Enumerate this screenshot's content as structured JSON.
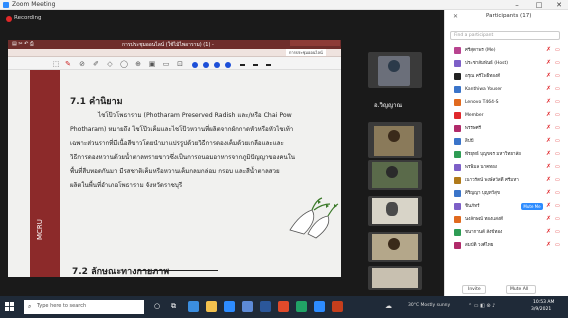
{
  "window": {
    "title": "Zoom Meeting",
    "minimize": "–",
    "maximize": "□",
    "close": "✕"
  },
  "recording": {
    "label": "Recording"
  },
  "shared_window": {
    "title": "การประชุมออนไลน์ (ใช้ไม้ไพอาราม) (1) - ",
    "tab_label": "การประชุมออนไลน์"
  },
  "document": {
    "side_label": "MCRU",
    "section_title": "7.1 คำนิยาม",
    "paragraphs": [
      "ไชโป๊วโพธาราม (Photharam Preserved Radish และ/หรือ Chai Pow",
      "Photharam) หมายถึง ไชโป๊วเค็มและไชโป๊วหวานที่ผลิตจากผักกาดหัวหรือหัวไชเท้า",
      "เฉพาะส่วนรากที่มีเนื้อสีขาวโดยนำมาแปรรูปด้วยวิธีการดองเค็มด้วยเกลือและและ",
      "วิธีการดองหวานด้วยน้ำตาลทรายขาวซึ่งเป็นการถนอมอาหารจากภูมิปัญญาของคนใน",
      "พื้นที่สืบทอดกันมา มีรสชาติเค็มหรือหวานเค็มกลมกล่อม กรอบ และสีน้ำตาลสวย",
      "ผลิตในพื้นที่อำเภอโพธาราม จังหวัดราชบุรี"
    ],
    "section_title2": "7.2 ลักษณะทางกายภาพ"
  },
  "videos": {
    "center_label": "อ.วิญญาณ"
  },
  "participants": {
    "title": "Participants (17)",
    "search_placeholder": "Find a participant",
    "items": [
      {
        "name": "ศรีสุดาพร (Me)",
        "color": "#b8438f"
      },
      {
        "name": "ประชาสัมพันธ์ (Host)",
        "color": "#7d5fc7"
      },
      {
        "name": "อรุณ ครีโพธิ์ทองดี",
        "color": "#222222"
      },
      {
        "name": "Kanthiwa Youser",
        "color": "#3a74c9"
      },
      {
        "name": "Lenovo T464-S",
        "color": "#e06a1f"
      },
      {
        "name": "Member",
        "color": "#e0282c"
      },
      {
        "name": "พรรษศรี",
        "color": "#b02a6a"
      },
      {
        "name": "สิปปี",
        "color": "#3a74c9"
      },
      {
        "name": "พีรยุทธ์ บุญขจร มหาวิทยาลัย",
        "color": "#2e9c54"
      },
      {
        "name": "พรพิมล นาคทอง",
        "color": "#7d5fc7"
      },
      {
        "name": "เนาวรัตน์ พงษ์สวัสดิ์ ศรีมหา",
        "color": "#b07a1a"
      },
      {
        "name": "ศิริญญา บุญทวีสุข",
        "color": "#3a74c9"
      },
      {
        "name": "ชินภัทร์",
        "color": "#7d5fc7"
      },
      {
        "name": "นงลักษณ์ ทองแสงดี",
        "color": "#e06a1f"
      },
      {
        "name": "ชนากานต์ สังข์ทอง",
        "color": "#2e9c54"
      },
      {
        "name": "สมบัติ วงศ์ไทย",
        "color": "#b02a6a"
      }
    ],
    "mute_me": "Mute Me",
    "invite": "Invite",
    "mute_all": "Mute All"
  },
  "taskbar": {
    "search_placeholder": "Type here to search",
    "tray_text": "30°C Mostly sunny",
    "time": "10:53 AM",
    "date": "3/9/2021"
  }
}
